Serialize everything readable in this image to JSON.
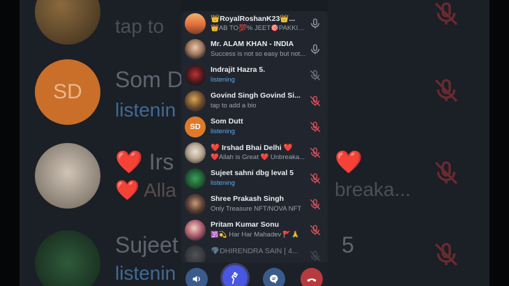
{
  "colors": {
    "listening": "#5fa8e6",
    "mic_muted": "#e0525c",
    "mic_active": "#9aa3ad",
    "end_call": "#b73a3e",
    "accent_button": "#4a57e0"
  },
  "participants": [
    {
      "name": "👑RoyalRoshanK23👑...",
      "status": "👑AB TO💯% JEET🎯PAKKI🏆...",
      "status_type": "bio",
      "mic": "active",
      "avatar": "photo-sunset"
    },
    {
      "name": "Mr. ALAM KHAN - INDIA",
      "status": "Success is not so easy but not...",
      "status_type": "bio",
      "mic": "active",
      "avatar": "photo-man"
    },
    {
      "name": "Indrajit Hazra 5.",
      "status": "listening",
      "status_type": "listening",
      "mic": "muted-grey",
      "avatar": "photo-biker"
    },
    {
      "name": "Govind Singh Govind Si...",
      "status": "tap to add a bio",
      "status_type": "bio",
      "mic": "muted",
      "avatar": "photo-text"
    },
    {
      "name": "Som Dutt",
      "status": "listening",
      "status_type": "listening",
      "mic": "muted",
      "avatar": "initials",
      "initials": "SD"
    },
    {
      "name": "❤️ Irshad Bhai Delhi ❤️",
      "status": "❤️Allah is Great ❤️ Unbreaka...",
      "status_type": "bio",
      "mic": "muted",
      "avatar": "photo-beard"
    },
    {
      "name": "Sujeet sahni dbg leval 5",
      "status": "listening",
      "status_type": "listening",
      "mic": "muted",
      "avatar": "photo-superteam"
    },
    {
      "name": "Shree Prakash Singh",
      "status": "Only Treasure NFT/NOVA NFT",
      "status_type": "bio",
      "mic": "muted",
      "avatar": "photo-glasses"
    },
    {
      "name": "Pritam Kumar Sonu",
      "status": "🕉️💫 Har Har Mahadev 🚩🙏",
      "status_type": "bio",
      "mic": "muted",
      "avatar": "photo-person"
    },
    {
      "name": "💎DHIRENDRA SAIN [ 4...",
      "status": "",
      "status_type": "bio",
      "mic": "muted-grey",
      "avatar": "photo-group"
    }
  ],
  "controls": [
    {
      "name": "speaker-button",
      "icon": "speaker-icon"
    },
    {
      "name": "raise-hand-button",
      "icon": "raise-hand-icon"
    },
    {
      "name": "chat-button",
      "icon": "chat-bubble-icon"
    },
    {
      "name": "end-call-button",
      "icon": "hang-up-icon"
    }
  ],
  "background": {
    "row1_sub": "tap to",
    "row2_name": "Som D",
    "row2_sub": "listenin",
    "row2_initials": "SD",
    "row3_name": "❤️ Irs",
    "row3_sub": "❤️ Alla",
    "row3_right_name": "❤️",
    "row3_right_sub": "breaka...",
    "row4_name": "Sujeet",
    "row4_sub": "listenin",
    "row4_right": "5"
  }
}
